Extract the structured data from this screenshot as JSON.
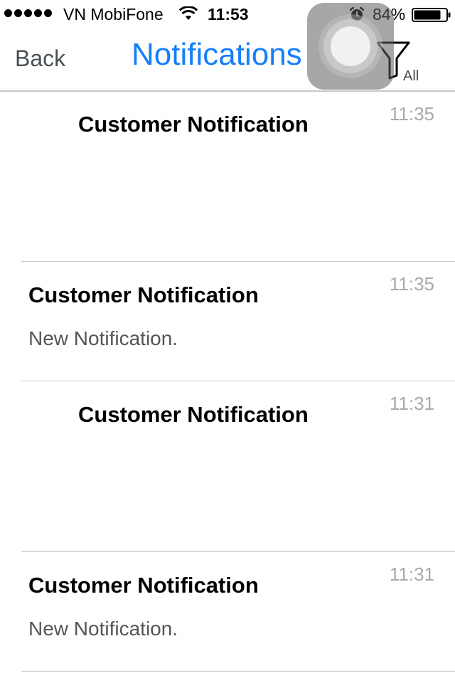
{
  "status_bar": {
    "carrier": "VN MobiFone",
    "time": "11:53",
    "battery_percent": "84%",
    "battery_level": 0.84,
    "signal_dots": 5,
    "icons": [
      "signal-dots",
      "wifi-icon",
      "alarm-icon",
      "battery-icon"
    ]
  },
  "nav": {
    "back_label": "Back",
    "title": "Notifications",
    "filter_label": "All",
    "filter_icon": "funnel-icon",
    "title_color": "#157efb"
  },
  "notifications": [
    {
      "title": "Customer Notification",
      "time": "11:35",
      "body": ""
    },
    {
      "title": "Customer Notification",
      "time": "11:35",
      "body": "New Notification."
    },
    {
      "title": "Customer Notification",
      "time": "11:31",
      "body": ""
    },
    {
      "title": "Customer Notification",
      "time": "11:31",
      "body": "New Notification."
    }
  ]
}
